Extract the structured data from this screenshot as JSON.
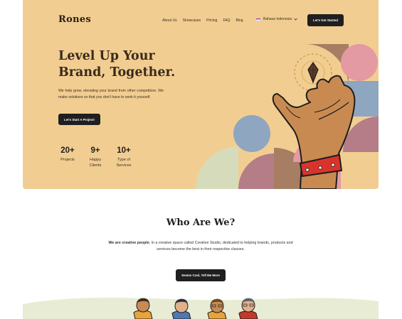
{
  "brand": {
    "name": "Rones"
  },
  "nav": {
    "links": [
      "About Us",
      "Showcases",
      "Pricing",
      "FAQ",
      "Blog"
    ],
    "language": "Bahasa Indonesia",
    "cta_label": "Let's Get Started"
  },
  "hero": {
    "title_line1": "Level Up Your",
    "title_line2": "Brand, Together.",
    "description": "We help grow, elevating your brand from other competitors. We make solutions so that you don't have to work it yourself.",
    "button_label": "Let's Start A Project!"
  },
  "stats": [
    {
      "value": "20+",
      "label_line1": "Projects",
      "label_line2": ""
    },
    {
      "value": "9+",
      "label_line1": "Happy",
      "label_line2": "Clients"
    },
    {
      "value": "10+",
      "label_line1": "Type of",
      "label_line2": "Services"
    }
  ],
  "about": {
    "heading": "Who Are We?",
    "emphasis": "We are creative people",
    "text_rest": ", in a creative space called Creative Studio, dedicated to helping brands, products and services become the best in their respective classes.",
    "button_label": "Seems Cool, Tell Me More"
  },
  "colors": {
    "hero_bg": "#f2cd91",
    "dark": "#1f1f1f",
    "rose": "#d9a1a0",
    "blue": "#8ea6bf",
    "brown": "#a77d63",
    "sage": "#d6dbbb",
    "mauve": "#b47d87",
    "band_red": "#d9342b"
  },
  "icons": [
    "diamond-icon",
    "flag-indonesia-icon",
    "chevron-down-icon"
  ]
}
